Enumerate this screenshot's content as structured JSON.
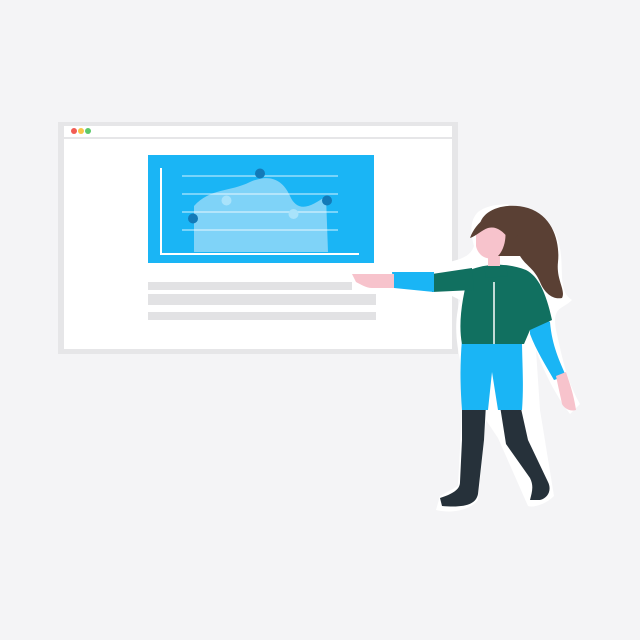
{
  "colors": {
    "background": "#f4f4f6",
    "window_frame": "#e6e6e8",
    "window_body": "#ffffff",
    "dot_red": "#f25c54",
    "dot_yellow": "#f7c548",
    "dot_green": "#5cc96b",
    "chart_bg": "#1ab5f5",
    "chart_area": "#7fd3f8",
    "chart_dark_point": "#137ab8",
    "chart_light_point": "#a9e3fb",
    "text_bar": "#e2e2e4",
    "hair": "#5a4034",
    "skin": "#f7c3cc",
    "jacket": "#117060",
    "sleeve": "#1ab5f5",
    "pants": "#1ab5f5",
    "boots": "#26313a",
    "outline": "#ffffff"
  },
  "browser": {
    "dots": [
      "dot-red",
      "dot-yellow",
      "dot-green"
    ]
  },
  "illustration": {
    "chart_points": [
      {
        "level": 0.35,
        "shade": "dark"
      },
      {
        "level": 0.55,
        "shade": "light"
      },
      {
        "level": 0.85,
        "shade": "dark"
      },
      {
        "level": 0.4,
        "shade": "light"
      },
      {
        "level": 0.55,
        "shade": "dark"
      }
    ],
    "text_lines": 3
  }
}
